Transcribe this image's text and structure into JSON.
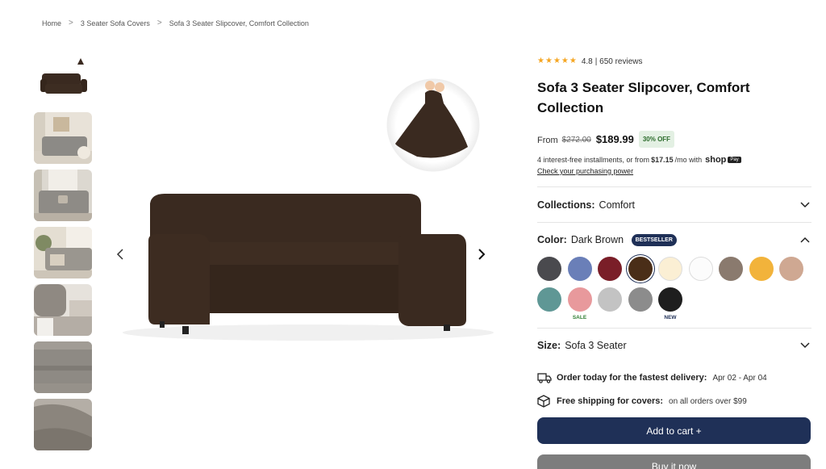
{
  "breadcrumb": {
    "items": [
      "Home",
      "3 Seater Sofa Covers",
      "Sofa 3 Seater Slipcover, Comfort Collection"
    ],
    "separator": ">"
  },
  "gallery": {
    "thumbnails": [
      "product-sofa-thumb",
      "living-room-thumb",
      "window-room-thumb",
      "plant-room-thumb",
      "closeup-cushion-thumb",
      "fabric-texture-thumb",
      "fabric-detail-thumb"
    ],
    "prev_icon": "chevron-left-icon",
    "next_icon": "chevron-right-icon",
    "main_color": "#3a2a20"
  },
  "product": {
    "rating": "4.8",
    "reviews": "| 650 reviews",
    "star_count": 5,
    "star_color": "#f5a623",
    "title": "Sofa 3 Seater Slipcover, Comfort Collection",
    "from_label": "From",
    "old_price": "$272.00",
    "price": "$189.99",
    "discount": "30% OFF",
    "install_prefix": "4 interest-free installments, or from",
    "install_amount": "$17.15",
    "install_suffix": "/mo with",
    "shop_logo": "shop",
    "shop_pay": "Pay",
    "check_power": "Check your purchasing power"
  },
  "collections": {
    "label": "Collections:",
    "value": "Comfort"
  },
  "color": {
    "label": "Color:",
    "value": "Dark Brown",
    "badge": "BESTSELLER",
    "swatches": [
      {
        "name": "charcoal",
        "hex": "#4a4a4e",
        "tag": ""
      },
      {
        "name": "blue",
        "hex": "#6a7fb8",
        "tag": ""
      },
      {
        "name": "burgundy",
        "hex": "#7a1e28",
        "tag": ""
      },
      {
        "name": "dark-brown",
        "hex": "#4a2e18",
        "tag": "",
        "selected": true
      },
      {
        "name": "cream",
        "hex": "#fbefd4",
        "tag": "",
        "light": true
      },
      {
        "name": "white",
        "hex": "#fcfcfc",
        "tag": "",
        "light": true
      },
      {
        "name": "taupe",
        "hex": "#8a7a6e",
        "tag": ""
      },
      {
        "name": "mustard",
        "hex": "#f2b33b",
        "tag": ""
      },
      {
        "name": "beige",
        "hex": "#cfa892",
        "tag": ""
      },
      {
        "name": "teal",
        "hex": "#5f9795",
        "tag": ""
      },
      {
        "name": "pink",
        "hex": "#e8999c",
        "tag": "SALE"
      },
      {
        "name": "light-grey",
        "hex": "#c3c3c3",
        "tag": ""
      },
      {
        "name": "grey",
        "hex": "#8c8c8c",
        "tag": ""
      },
      {
        "name": "black",
        "hex": "#1e1e1e",
        "tag": "NEW"
      }
    ]
  },
  "size": {
    "label": "Size:",
    "value": "Sofa 3 Seater"
  },
  "delivery": {
    "fast_label": "Order today for the fastest delivery:",
    "fast_value": "Apr 02 - Apr 04",
    "ship_label": "Free shipping for covers:",
    "ship_value": "on all orders over $99"
  },
  "actions": {
    "add_to_cart": "Add to cart +",
    "buy_now": "Buy it now"
  },
  "colors": {
    "primary": "#1f3057",
    "star": "#f5a623",
    "sale": "#2e7d32"
  }
}
